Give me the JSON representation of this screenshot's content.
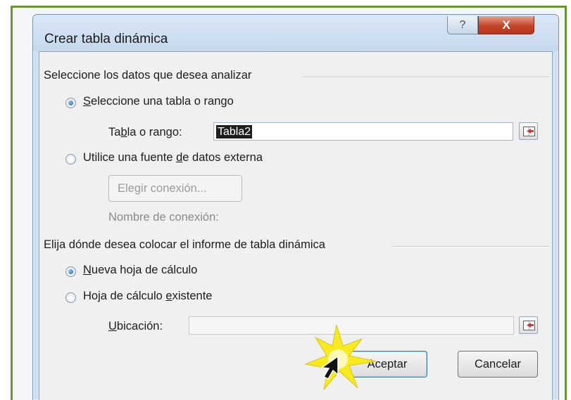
{
  "dialog": {
    "title": "Crear tabla dinámica",
    "help_label": "?",
    "close_label": "X"
  },
  "source_group": {
    "heading": "Seleccione los datos que desea analizar",
    "option_table": {
      "prefix": "",
      "mnemonic": "S",
      "suffix": "eleccione una tabla o rango",
      "selected": true
    },
    "table_range": {
      "prefix": "Ta",
      "mnemonic": "b",
      "suffix": "la o rango:",
      "value": "Tabla2"
    },
    "option_external": {
      "prefix": "Utilice una fuente ",
      "mnemonic": "d",
      "suffix": "e datos externa",
      "selected": false
    },
    "choose_connection_label": "Elegir conexión...",
    "connection_name_label": "Nombre de conexión:"
  },
  "destination_group": {
    "heading": "Elija dónde desea colocar el informe de tabla dinámica",
    "option_new": {
      "prefix": "",
      "mnemonic": "N",
      "suffix": "ueva hoja de cálculo",
      "selected": true
    },
    "option_existing": {
      "prefix": "Hoja de cálculo ",
      "mnemonic": "e",
      "suffix": "xistente",
      "selected": false
    },
    "location": {
      "prefix": "",
      "mnemonic": "U",
      "suffix": "bicación:",
      "value": ""
    }
  },
  "buttons": {
    "accept_label": "Aceptar",
    "cancel_label": "Cancelar"
  },
  "icons": {
    "range_picker": "range-picker-icon",
    "cursor": "mouse-pointer-icon",
    "highlight": "starburst-icon"
  },
  "colors": {
    "frame_border": "#6a9433",
    "title_bar": "#c6d8ee",
    "close_button": "#c4452a",
    "highlight": "#f7ea1f"
  }
}
